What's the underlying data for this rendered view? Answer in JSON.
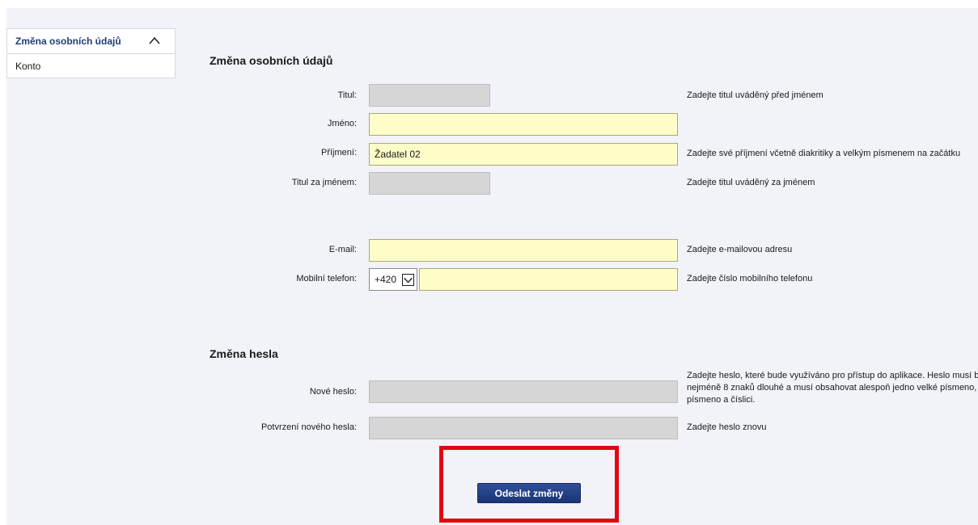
{
  "sidebar": {
    "items": [
      {
        "label": "Změna osobních údajů",
        "icon": "chevron-up-icon",
        "active": true
      },
      {
        "label": "Konto",
        "active": false
      }
    ]
  },
  "personal": {
    "title": "Změna osobních údajů",
    "titul": {
      "label": "Titul:",
      "value": "",
      "hint": "Zadejte titul uváděný před jménem"
    },
    "jmeno": {
      "label": "Jméno:",
      "value": ""
    },
    "prijmeni": {
      "label": "Příjmení:",
      "value": "Žadatel 02",
      "hint": "Zadejte své příjmení včetně diakritiky a velkým písmenem na začátku"
    },
    "titul_za": {
      "label": "Titul za jménem:",
      "value": "",
      "hint": "Zadejte titul uváděný za jménem"
    },
    "email": {
      "label": "E-mail:",
      "value": "",
      "hint": "Zadejte e-mailovou adresu"
    },
    "phone": {
      "label": "Mobilní telefon:",
      "prefix": "+420",
      "value": "",
      "hint": "Zadejte číslo mobilního telefonu"
    }
  },
  "password": {
    "title": "Změna hesla",
    "new": {
      "label": "Nové heslo:",
      "value": "",
      "hint_lines": [
        "Zadejte heslo, které bude využíváno pro přístup do aplikace. Heslo musí b",
        "nejméně 8 znaků dlouhé a musí obsahovat alespoň jedno velké písmeno,",
        "písmeno a číslici."
      ]
    },
    "confirm": {
      "label": "Potvrzení nového hesla:",
      "value": "",
      "hint": "Zadejte heslo znovu"
    }
  },
  "actions": {
    "submit_label": "Odeslat změny"
  },
  "colors": {
    "accent": "#1f3d7a",
    "required_field": "#fefdc8",
    "disabled_field": "#d6d6d6",
    "highlight": "#e30613"
  }
}
